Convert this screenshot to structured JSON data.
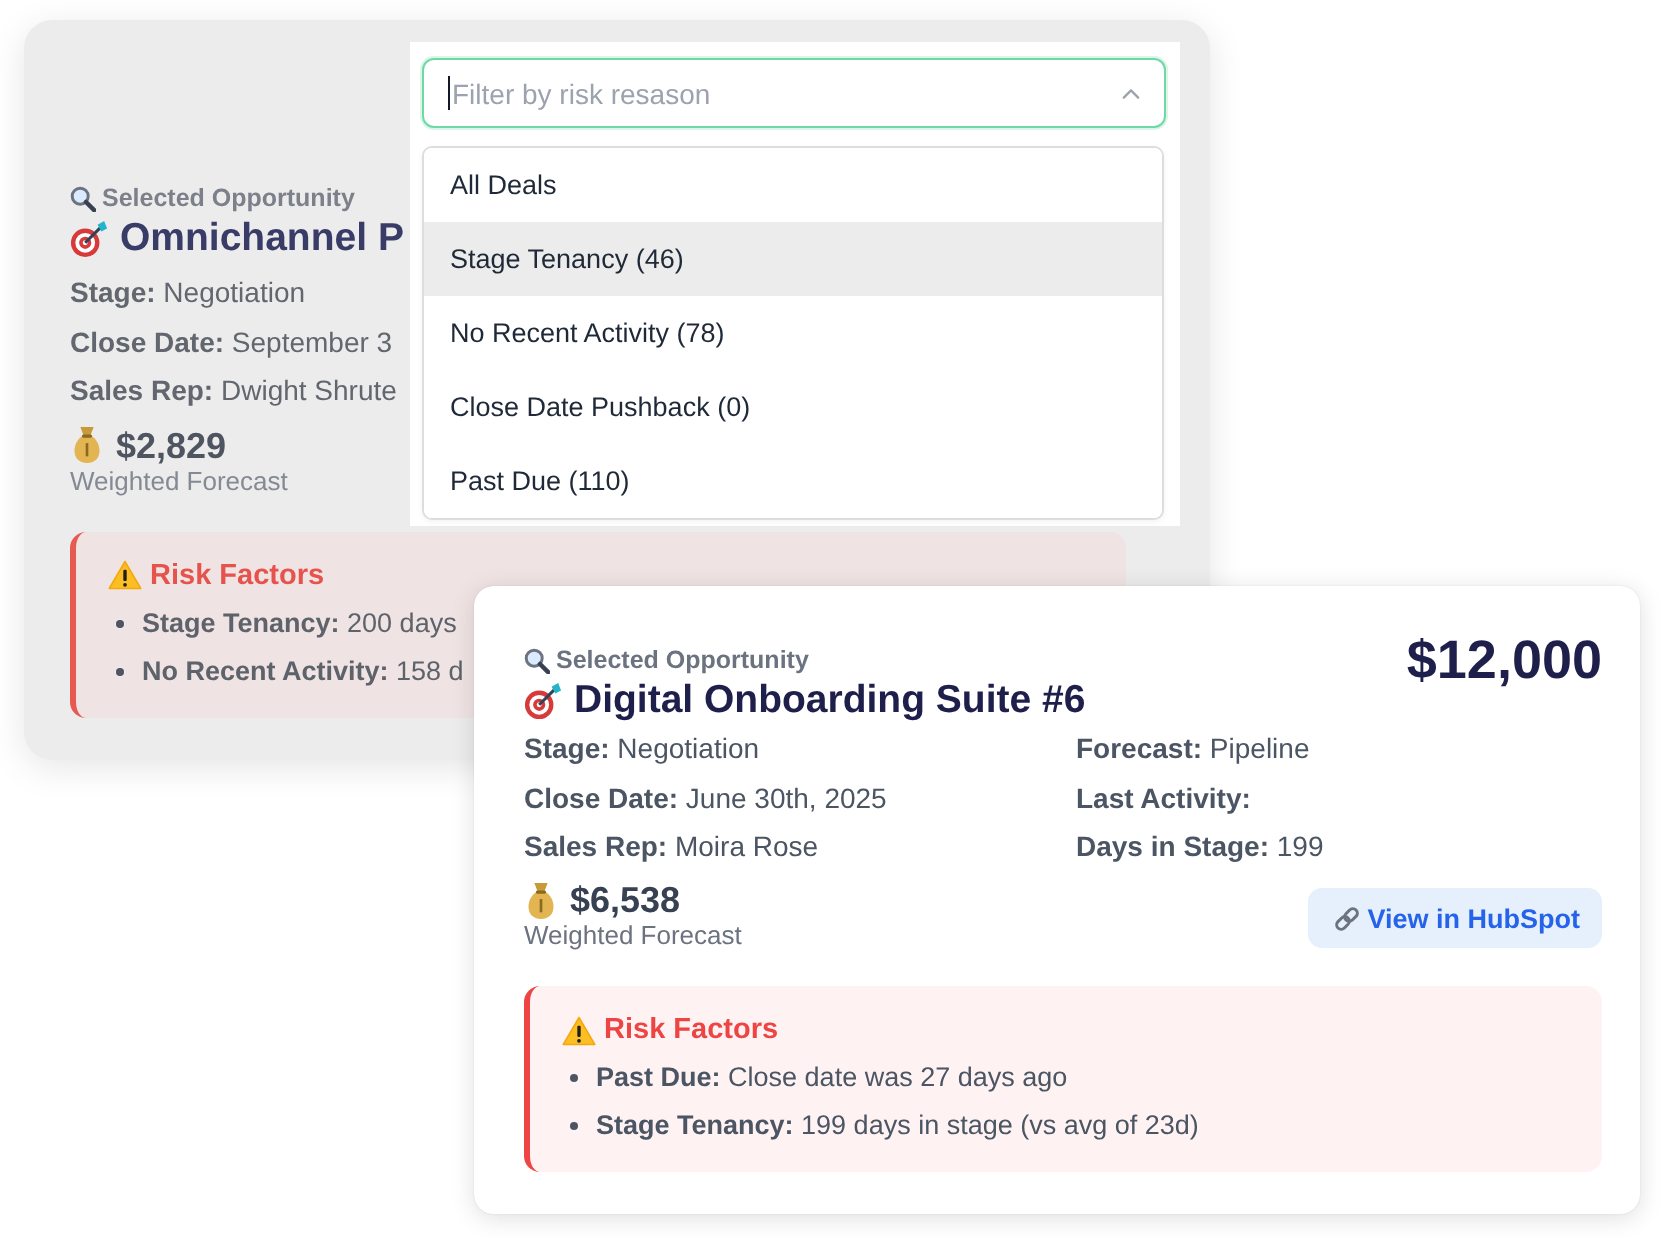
{
  "background_card": {
    "subtitle": "Selected Opportunity",
    "title": "Omnichannel P",
    "details": [
      {
        "label": "Stage:",
        "value": "Negotiation"
      },
      {
        "label": "Close Date:",
        "value": "September 3"
      },
      {
        "label": "Sales Rep:",
        "value": "Dwight Shrute"
      }
    ],
    "weighted_forecast": {
      "amount": "$2,829",
      "caption": "Weighted Forecast"
    },
    "risk_factors": {
      "title": "Risk Factors",
      "items": [
        {
          "label": "Stage Tenancy:",
          "text": "200 days"
        },
        {
          "label": "No Recent Activity:",
          "text": "158 d"
        }
      ]
    }
  },
  "filter_dropdown": {
    "placeholder": "Filter by risk resason",
    "focused": true,
    "expanded": true,
    "options": [
      {
        "label": "All Deals",
        "selected": false
      },
      {
        "label": "Stage Tenancy (46)",
        "selected": true
      },
      {
        "label": "No Recent Activity (78)",
        "selected": false
      },
      {
        "label": "Close Date Pushback (0)",
        "selected": false
      },
      {
        "label": "Past Due (110)",
        "selected": false
      }
    ]
  },
  "opportunity_card": {
    "subtitle": "Selected Opportunity",
    "title": "Digital Onboarding Suite #6",
    "amount": "$12,000",
    "details": [
      {
        "label": "Stage:",
        "value": "Negotiation"
      },
      {
        "label": "Forecast:",
        "value": "Pipeline"
      },
      {
        "label": "Close Date:",
        "value": "June 30th, 2025"
      },
      {
        "label": "Last Activity:"
      },
      {
        "label": "Sales Rep:",
        "value": "Moira Rose"
      },
      {
        "label": "Days in Stage:",
        "value": "199"
      }
    ],
    "weighted_forecast": {
      "amount": "$6,538",
      "caption": "Weighted Forecast"
    },
    "link_button": "View in HubSpot",
    "risk_factors": {
      "title": "Risk Factors",
      "items": [
        {
          "label": "Past Due:",
          "text": "Close date was 27 days ago"
        },
        {
          "label": "Stage Tenancy:",
          "text": "199 days in stage (vs avg of 23d)"
        }
      ]
    }
  }
}
